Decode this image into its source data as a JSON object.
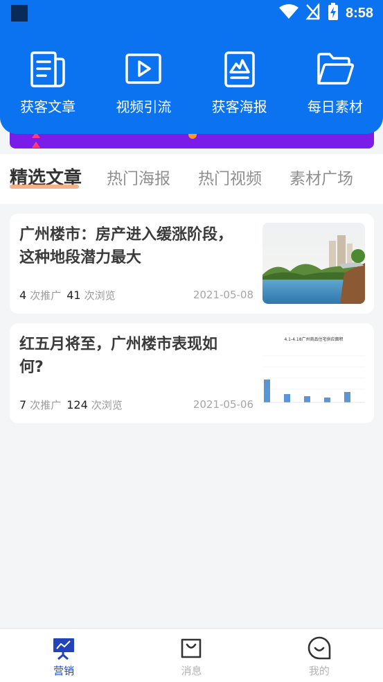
{
  "status_bar": {
    "time": "8:58",
    "icons": [
      "app-square-icon",
      "wifi-icon",
      "no-signal-icon",
      "battery-charging-icon"
    ]
  },
  "quick_nav": [
    {
      "label": "获客文章",
      "icon": "article-doc-icon"
    },
    {
      "label": "视频引流",
      "icon": "video-play-icon"
    },
    {
      "label": "获客海报",
      "icon": "poster-icon"
    },
    {
      "label": "每日素材",
      "icon": "folder-icon"
    }
  ],
  "tabs": [
    {
      "label": "精选文章",
      "active": true
    },
    {
      "label": "热门海报",
      "active": false
    },
    {
      "label": "热门视频",
      "active": false
    },
    {
      "label": "素材广场",
      "active": false
    }
  ],
  "articles": [
    {
      "title": "广州楼市：房产进入缓涨阶段，这种地段潜力最大",
      "promotions": "4",
      "promotions_label": "次推广",
      "views": "41",
      "views_label": "次浏览",
      "date": "2021-05-08",
      "thumb": "real-estate-lake-photo"
    },
    {
      "title": "红五月将至，广州楼市表现如何?",
      "promotions": "7",
      "promotions_label": "次推广",
      "views": "124",
      "views_label": "次浏览",
      "date": "2021-05-06",
      "thumb": "supply-bar-chart",
      "thumb_chart_title": "4.1-4.18广州商品住宅供应面积"
    }
  ],
  "bottom_nav": [
    {
      "label": "营销",
      "icon": "marketing-board-icon",
      "active": true
    },
    {
      "label": "消息",
      "icon": "shopping-bag-icon",
      "active": false
    },
    {
      "label": "我的",
      "icon": "smile-face-icon",
      "active": false
    }
  ],
  "colors": {
    "primary": "#0b73f0",
    "banner": "#7a1de8",
    "active_nav": "#1f4cc9",
    "tab_underline": "#f6a87a"
  }
}
